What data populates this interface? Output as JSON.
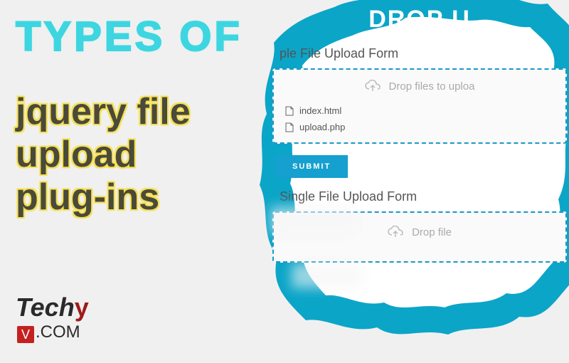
{
  "headline": {
    "types": "TYPES",
    "of": "OF"
  },
  "subtitle": {
    "line1": "jquery file",
    "line2": "upload",
    "line3": "plug-ins"
  },
  "form": {
    "drop_header": "DROP U",
    "multiple_title": "ple File Upload Form",
    "drop_hint": "Drop files to uploa",
    "files": [
      {
        "name": "index.html"
      },
      {
        "name": "upload.php"
      }
    ],
    "submit_label": "SUBMIT",
    "single_title": "Single File Upload Form",
    "single_hint": "Drop file"
  },
  "logo": {
    "part1": "Tech",
    "part2": "y",
    "part3": "V",
    "part4": ".COM"
  }
}
